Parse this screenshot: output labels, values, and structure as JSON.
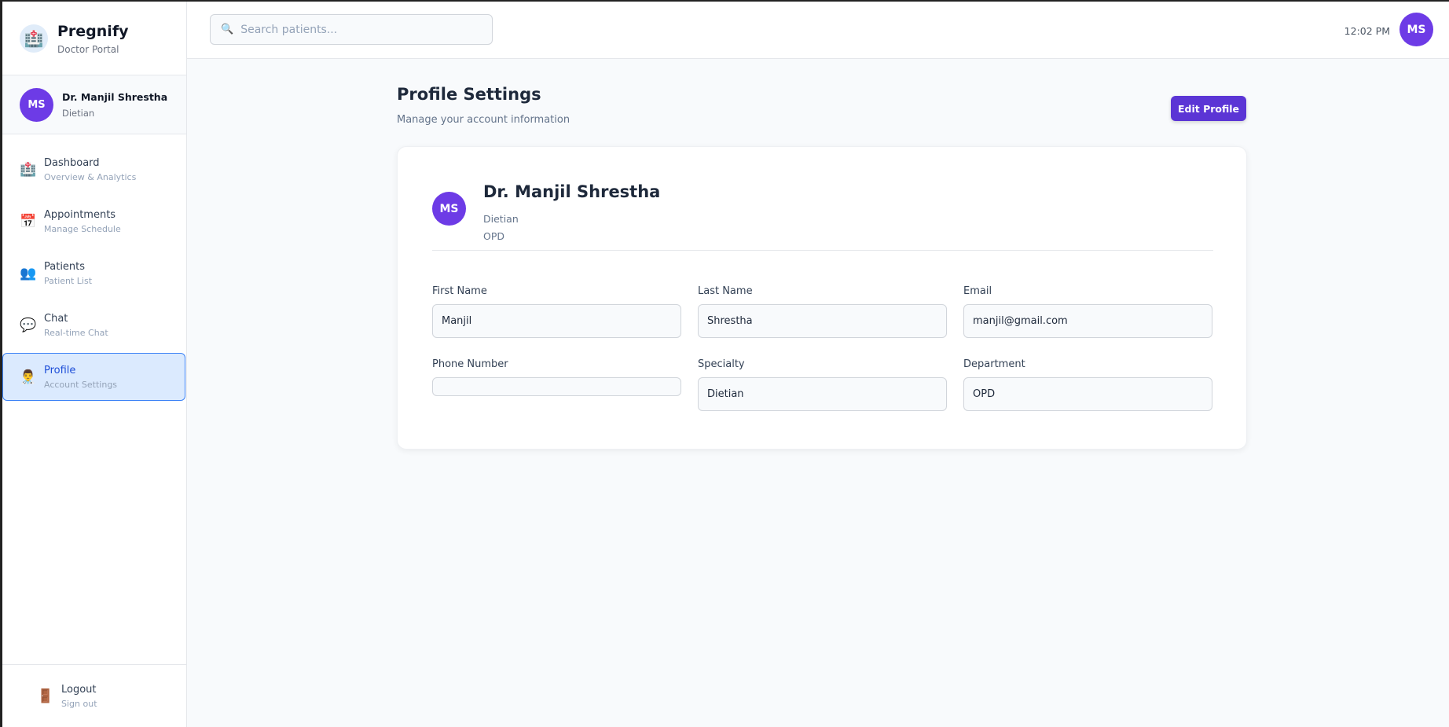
{
  "brand": {
    "name": "Pregnify",
    "subtitle": "Doctor Portal",
    "logo_icon": "hospital-icon"
  },
  "user": {
    "initials": "MS",
    "name": "Dr. Manjil Shrestha",
    "role": "Dietian"
  },
  "nav": [
    {
      "label": "Dashboard",
      "sub": "Overview & Analytics",
      "icon": "🏥",
      "icon_name": "hospital-icon",
      "active": false
    },
    {
      "label": "Appointments",
      "sub": "Manage Schedule",
      "icon": "📅",
      "icon_name": "calendar-icon",
      "active": false
    },
    {
      "label": "Patients",
      "sub": "Patient List",
      "icon": "👥",
      "icon_name": "users-icon",
      "active": false
    },
    {
      "label": "Chat",
      "sub": "Real-time Chat",
      "icon": "💬",
      "icon_name": "chat-icon",
      "active": false
    },
    {
      "label": "Profile",
      "sub": "Account Settings",
      "icon": "👨‍⚕️",
      "icon_name": "doctor-icon",
      "active": true
    }
  ],
  "logout": {
    "label": "Logout",
    "sub": "Sign out",
    "icon": "🚪"
  },
  "header": {
    "search_placeholder": "Search patients...",
    "search_icon": "🔍",
    "time": "12:02 PM",
    "initials": "MS"
  },
  "page": {
    "title": "Profile Settings",
    "subtitle": "Manage your account information",
    "edit_label": "Edit Profile"
  },
  "profile": {
    "initials": "MS",
    "name": "Dr. Manjil Shrestha",
    "role": "Dietian",
    "department": "OPD",
    "fields": {
      "first_name": {
        "label": "First Name",
        "value": "Manjil"
      },
      "last_name": {
        "label": "Last Name",
        "value": "Shrestha"
      },
      "email": {
        "label": "Email",
        "value": "manjil@gmail.com"
      },
      "phone": {
        "label": "Phone Number",
        "value": ""
      },
      "specialty": {
        "label": "Specialty",
        "value": "Dietian"
      },
      "department": {
        "label": "Department",
        "value": "OPD"
      }
    }
  },
  "colors": {
    "accent": "#6d3be6",
    "button": "#5b35d5",
    "active_bg": "#dbeafe",
    "active_border": "#3b82f6"
  }
}
